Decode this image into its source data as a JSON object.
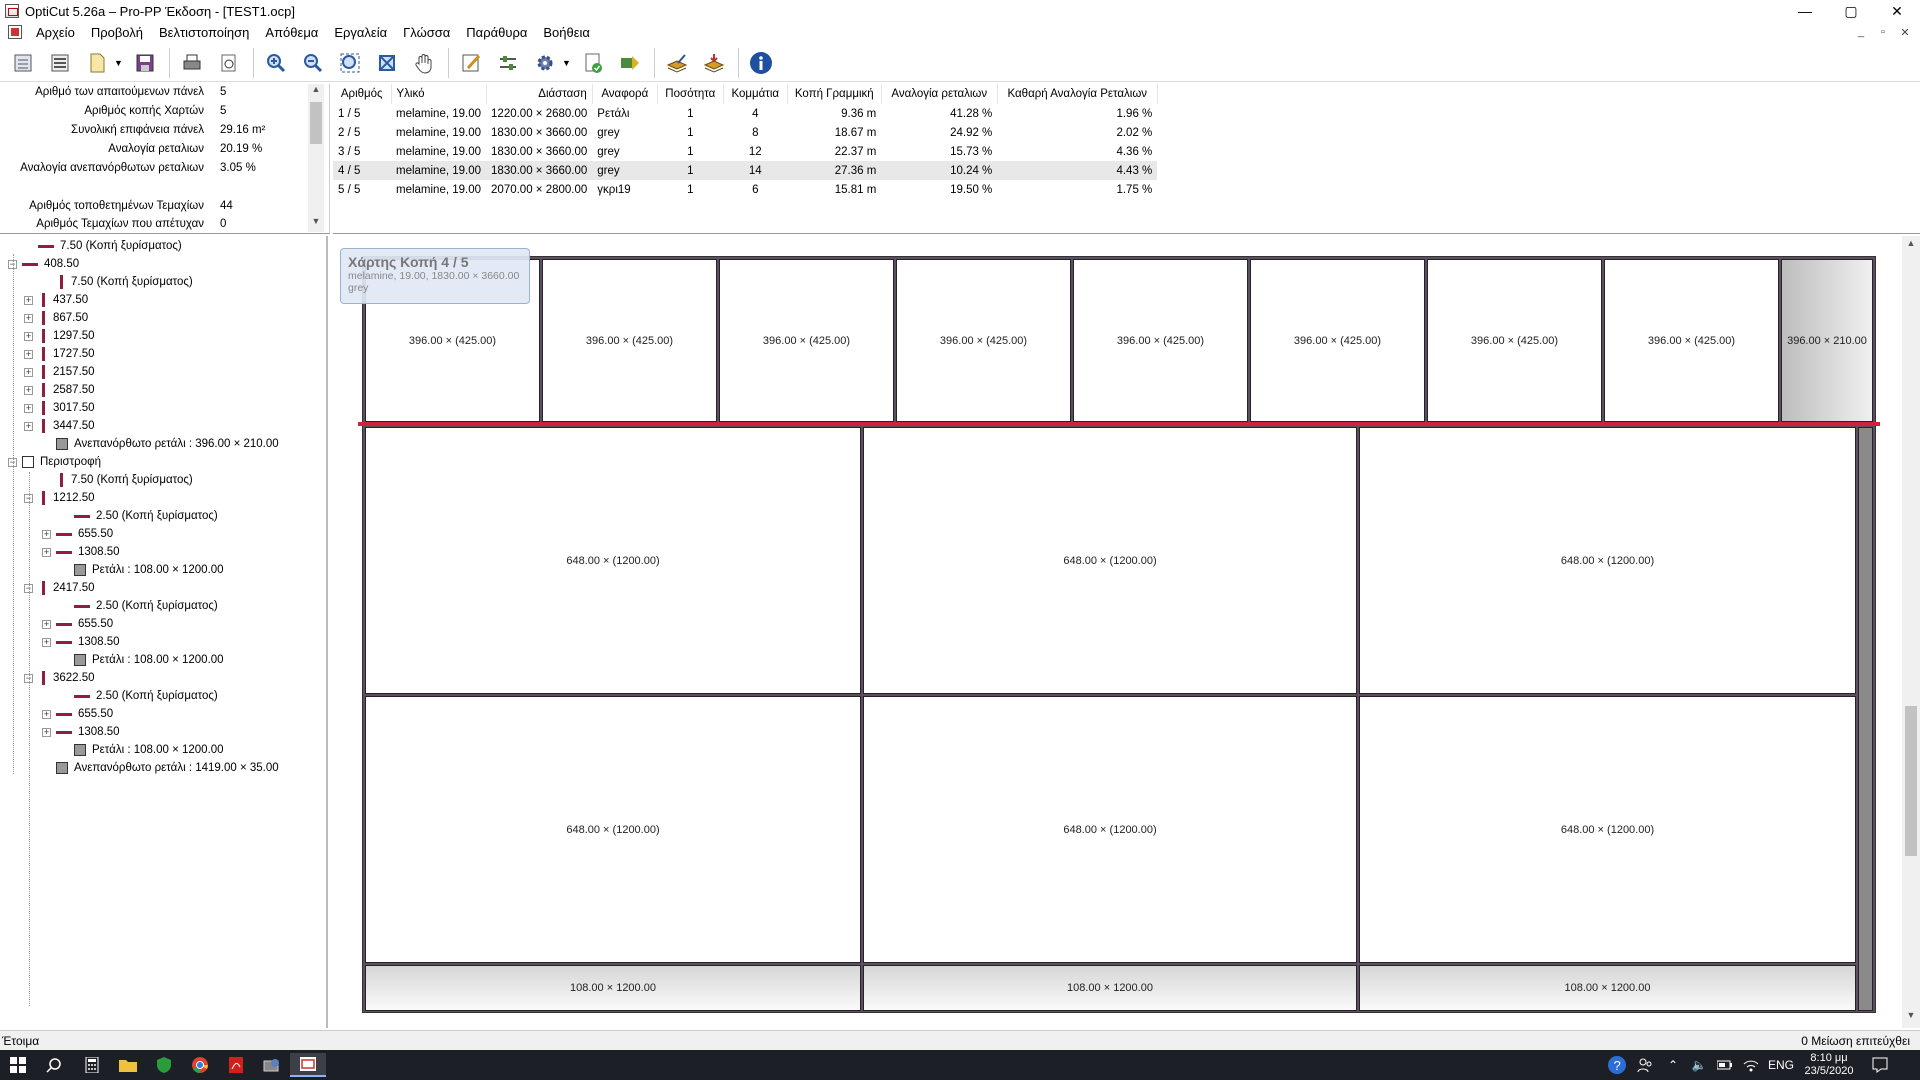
{
  "window": {
    "title": "OptiCut 5.26a – Pro-PP Έκδοση - [TEST1.ocp]",
    "min": "—",
    "max": "▢",
    "close": "✕"
  },
  "menu": [
    "Αρχείο",
    "Προβολή",
    "Βελτιστοποίηση",
    "Απόθεμα",
    "Εργαλεία",
    "Γλώσσα",
    "Παράθυρα",
    "Βοήθεια"
  ],
  "mdi": {
    "min": "_",
    "restore": "▫",
    "close": "✕"
  },
  "toolbar": [
    "list-view-icon",
    "list-view-2-icon",
    "new-file-icon",
    "dropdown-arrow",
    "save-icon",
    "print-icon",
    "print-preview-icon",
    "zoom-in-icon",
    "zoom-out-icon",
    "zoom-fit-icon",
    "zoom-extent-icon",
    "pan-hand-icon",
    "edit-icon",
    "cut-settings-icon",
    "gear-icon",
    "dropdown-arrow",
    "report-icon",
    "export-icon",
    "stock-edit-icon",
    "stock-import-icon",
    "info-icon"
  ],
  "stats": [
    {
      "label": "Αριθμό των απαιτούμενων πάνελ",
      "value": "5"
    },
    {
      "label": "Αριθμός κοπής Χαρτών",
      "value": "5"
    },
    {
      "label": "Συνολική επιφάνεια πάνελ",
      "value": "29.16 m²"
    },
    {
      "label": "Αναλογία ρεταλιων",
      "value": "20.19 %"
    },
    {
      "label": "Αναλογία ανεπανόρθωτων ρεταλιων",
      "value": "3.05 %"
    },
    {
      "label": "",
      "value": ""
    },
    {
      "label": "Αριθμός τοποθετημένων Τεμαχίων",
      "value": "44"
    },
    {
      "label": "Αριθμός Τεμαχίων που απέτυχαν",
      "value": "0"
    }
  ],
  "table": {
    "headers": [
      "Αριθμός",
      "Υλικό",
      "Διάσταση",
      "Αναφορά",
      "Ποσότητα",
      "Κομμάτια",
      "Κοπή Γραμμική",
      "Αναλογία ρεταλιων",
      "Καθαρή Αναλογία Ρεταλιων"
    ],
    "rows": [
      [
        "1 / 5",
        "melamine, 19.00",
        "1220.00 × 2680.00",
        "Ρετάλι",
        "1",
        "4",
        "9.36 m",
        "41.28 %",
        "1.96 %"
      ],
      [
        "2 / 5",
        "melamine, 19.00",
        "1830.00 × 3660.00",
        "grey",
        "1",
        "8",
        "18.67 m",
        "24.92 %",
        "2.02 %"
      ],
      [
        "3 / 5",
        "melamine, 19.00",
        "1830.00 × 3660.00",
        "grey",
        "1",
        "12",
        "22.37 m",
        "15.73 %",
        "4.36 %"
      ],
      [
        "4 / 5",
        "melamine, 19.00",
        "1830.00 × 3660.00",
        "grey",
        "1",
        "14",
        "27.36 m",
        "10.24 %",
        "4.43 %"
      ],
      [
        "5 / 5",
        "melamine, 19.00",
        "2070.00 × 2800.00",
        "γκρι19",
        "1",
        "6",
        "15.81 m",
        "19.50 %",
        "1.75 %"
      ]
    ]
  },
  "tree": [
    {
      "d": 1,
      "k": "h",
      "t": "7.50 (Κοπή ξυρίσματος)",
      "e": ""
    },
    {
      "d": 0,
      "k": "h",
      "t": "408.50",
      "e": "−"
    },
    {
      "d": 2,
      "k": "v",
      "t": "7.50 (Κοπή ξυρίσματος)",
      "e": ""
    },
    {
      "d": 1,
      "k": "v",
      "t": "437.50",
      "e": "+"
    },
    {
      "d": 1,
      "k": "v",
      "t": "867.50",
      "e": "+"
    },
    {
      "d": 1,
      "k": "v",
      "t": "1297.50",
      "e": "+"
    },
    {
      "d": 1,
      "k": "v",
      "t": "1727.50",
      "e": "+"
    },
    {
      "d": 1,
      "k": "v",
      "t": "2157.50",
      "e": "+"
    },
    {
      "d": 1,
      "k": "v",
      "t": "2587.50",
      "e": "+"
    },
    {
      "d": 1,
      "k": "v",
      "t": "3017.50",
      "e": "+"
    },
    {
      "d": 1,
      "k": "v",
      "t": "3447.50",
      "e": "+"
    },
    {
      "d": 2,
      "k": "b",
      "t": "Ανεπανόρθωτο ρετάλι : 396.00 × 210.00",
      "e": ""
    },
    {
      "d": 0,
      "k": "e",
      "t": "Περιστροφή",
      "e": "−"
    },
    {
      "d": 2,
      "k": "v",
      "t": "7.50 (Κοπή ξυρίσματος)",
      "e": ""
    },
    {
      "d": 1,
      "k": "v",
      "t": "1212.50",
      "e": "−"
    },
    {
      "d": 3,
      "k": "h",
      "t": "2.50 (Κοπή ξυρίσματος)",
      "e": ""
    },
    {
      "d": 2,
      "k": "h",
      "t": "655.50",
      "e": "+"
    },
    {
      "d": 2,
      "k": "h",
      "t": "1308.50",
      "e": "+"
    },
    {
      "d": 3,
      "k": "b",
      "t": "Ρετάλι : 108.00 × 1200.00",
      "e": ""
    },
    {
      "d": 1,
      "k": "v",
      "t": "2417.50",
      "e": "−"
    },
    {
      "d": 3,
      "k": "h",
      "t": "2.50 (Κοπή ξυρίσματος)",
      "e": ""
    },
    {
      "d": 2,
      "k": "h",
      "t": "655.50",
      "e": "+"
    },
    {
      "d": 2,
      "k": "h",
      "t": "1308.50",
      "e": "+"
    },
    {
      "d": 3,
      "k": "b",
      "t": "Ρετάλι : 108.00 × 1200.00",
      "e": ""
    },
    {
      "d": 1,
      "k": "v",
      "t": "3622.50",
      "e": "−"
    },
    {
      "d": 3,
      "k": "h",
      "t": "2.50 (Κοπή ξυρίσματος)",
      "e": ""
    },
    {
      "d": 2,
      "k": "h",
      "t": "655.50",
      "e": "+"
    },
    {
      "d": 2,
      "k": "h",
      "t": "1308.50",
      "e": "+"
    },
    {
      "d": 3,
      "k": "b",
      "t": "Ρετάλι : 108.00 × 1200.00",
      "e": ""
    },
    {
      "d": 2,
      "k": "b",
      "t": "Ανεπανόρθωτο ρετάλι : 1419.00 × 35.00",
      "e": ""
    }
  ],
  "sheet": {
    "tooltip_title": "Χάρτης Κοπή 4 / 5",
    "tooltip_line1": "melamine, 19.00, 1830.00 × 3660.00",
    "tooltip_line2": "grey",
    "top_piece": "396.00 × (425.00)",
    "top_offcut": "396.00 × 210.00",
    "big_piece": "648.00 × (1200.00)",
    "bottom_offcut": "108.00 × 1200.00"
  },
  "status": {
    "left": "Έτοιμα",
    "right": "0 Μείωση επιτεύχθει"
  },
  "taskbar": {
    "lang": "ENG",
    "time": "8:10 μμ",
    "date": "23/5/2020"
  }
}
